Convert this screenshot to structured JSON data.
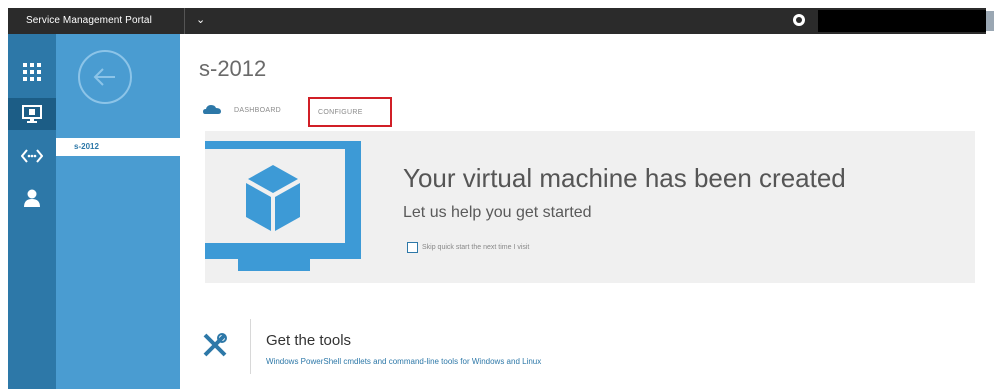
{
  "header": {
    "portal_title": "Service Management Portal",
    "menu_chevron": "⌄",
    "icons": [
      "globe-icon",
      "account-avatar-icon"
    ]
  },
  "leftnav": {
    "items": [
      {
        "name": "all-items",
        "icon": "grid-icon",
        "active": false
      },
      {
        "name": "virtual-machines",
        "icon": "monitor-icon",
        "active": true
      },
      {
        "name": "networks",
        "icon": "network-icon",
        "active": false
      },
      {
        "name": "users",
        "icon": "user-icon",
        "active": false
      }
    ]
  },
  "subnav": {
    "items": [
      {
        "label": "s-2012",
        "selected": true
      }
    ],
    "back_icon": "back-arrow-icon"
  },
  "main": {
    "title": "s-2012",
    "tabs": [
      {
        "label": "DASHBOARD",
        "icon": "cloud-dashboard-icon"
      },
      {
        "label": "CONFIGURE",
        "highlighted": true
      }
    ]
  },
  "quickstart": {
    "title": "Your virtual machine has been created",
    "subtitle": "Let us help you get started",
    "skip_label": "Skip quick start the next time I visit",
    "skip_checked": false
  },
  "tools": {
    "title": "Get the tools",
    "description": "Windows PowerShell cmdlets and command-line tools for Windows and Linux",
    "icon": "tools-icon"
  },
  "colors": {
    "topbar": "#2b2b2b",
    "leftnav": "#2d78a8",
    "subnav": "#4a9cd1",
    "highlight": "#d11f26",
    "link": "#2d78a8"
  }
}
